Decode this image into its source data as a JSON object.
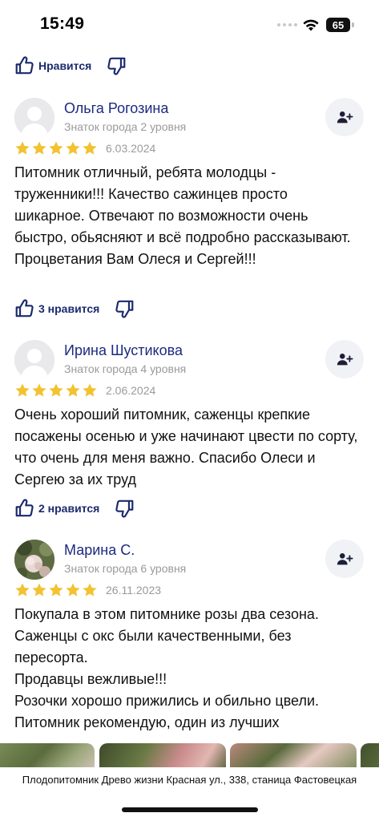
{
  "status_bar": {
    "time": "15:49",
    "battery": "65"
  },
  "top_reactions": {
    "like_label": "Нравится"
  },
  "reviews": [
    {
      "author": "Ольга Рогозина",
      "rank": "Знаток города 2 уровня",
      "rating": 5,
      "date": "6.03.2024",
      "text": [
        "Питомник отличный, ребята молодцы - труженники!!! Качество сажинцев просто шикарное. Отвечают по возможности очень быстро, обьясняют и всё подробно рассказывают. Процветания Вам Олеся и Сергей!!!"
      ],
      "likes_label": "3 нравится"
    },
    {
      "author": "Ирина Шустикова",
      "rank": "Знаток города 4 уровня",
      "rating": 5,
      "date": "2.06.2024",
      "text": [
        "Очень хороший питомник, саженцы крепкие посажены осенью и уже начинают цвести по сорту, что очень для меня важно. Спасибо Олеси и Сергею за их труд"
      ],
      "likes_label": "2 нравится"
    },
    {
      "author": "Марина С.",
      "rank": "Знаток города 6 уровня",
      "rating": 5,
      "date": "26.11.2023",
      "text": [
        "Покупала в этом питомнике розы два сезона. Саженцы с окс были качественными, без пересорта.",
        "Продавцы вежливые!!!",
        "Розочки хорошо прижились и обильно цвели. Питомник рекомендую, один из лучших"
      ]
    }
  ],
  "footer": {
    "address": "Плодопитомник Древо жизни Красная ул., 338, станица Фастовецкая"
  },
  "colors": {
    "accent_text": "#1c2a80",
    "star": "#f2c230",
    "muted": "#9a9a9a"
  }
}
